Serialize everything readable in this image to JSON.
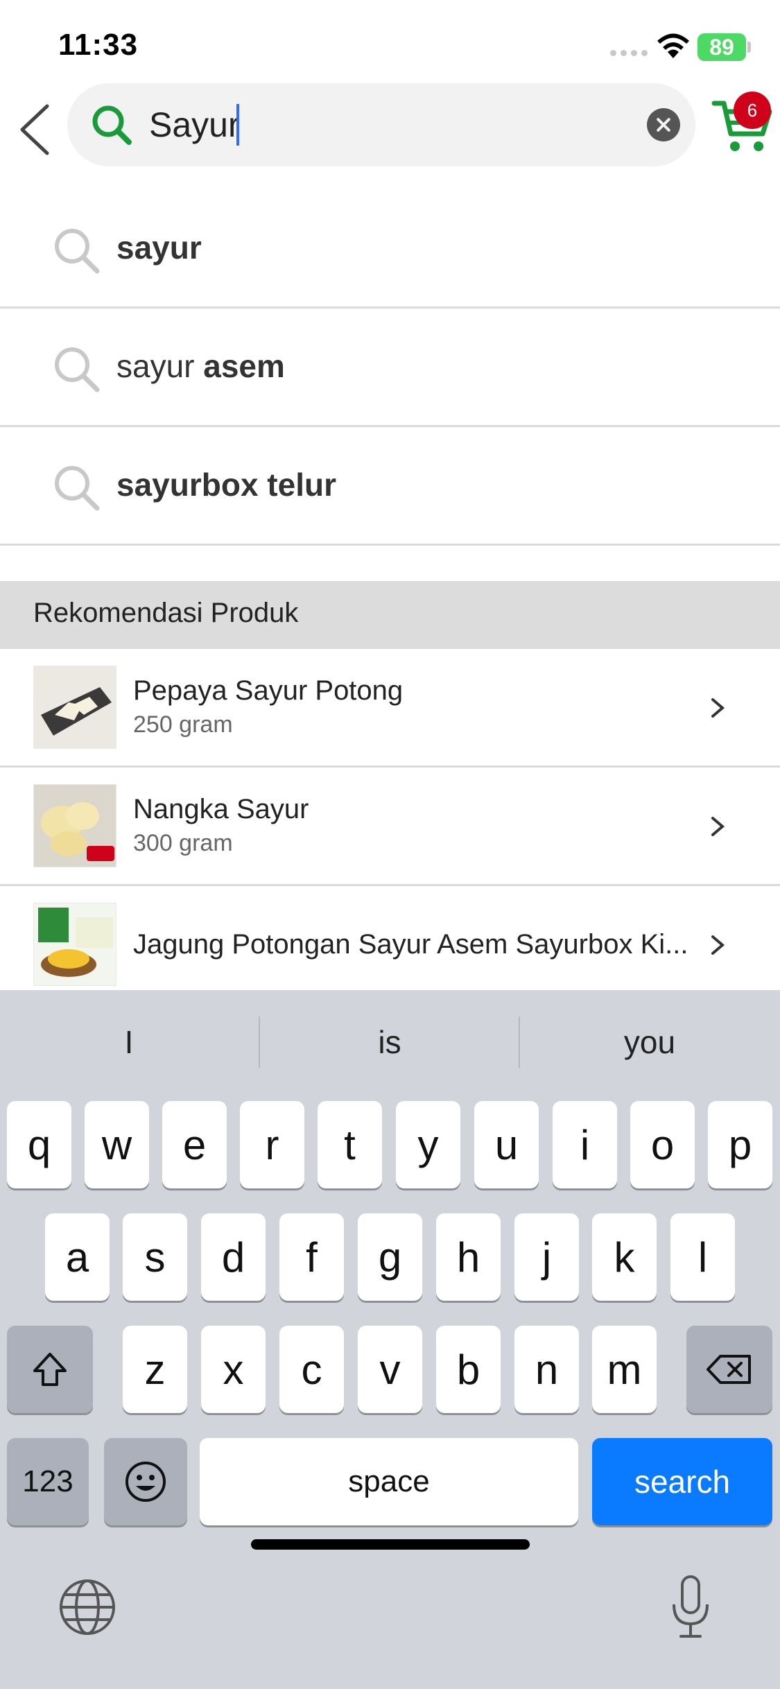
{
  "status_bar": {
    "time": "11:33",
    "battery": "89"
  },
  "search": {
    "query": "Sayur"
  },
  "cart": {
    "badge_count": "6"
  },
  "suggestions": [
    {
      "plain": "",
      "bold": "sayur"
    },
    {
      "plain": "sayur ",
      "bold": "asem"
    },
    {
      "plain": "",
      "bold": "sayurbox telur"
    }
  ],
  "recommendations": {
    "title": "Rekomendasi Produk",
    "items": [
      {
        "name": "Pepaya Sayur Potong",
        "weight": "250 gram"
      },
      {
        "name": "Nangka Sayur",
        "weight": "300 gram"
      },
      {
        "name": "Jagung Potongan Sayur Asem Sayurbox Ki...",
        "weight": ""
      }
    ]
  },
  "keyboard": {
    "predictions": [
      "I",
      "is",
      "you"
    ],
    "row1": [
      "q",
      "w",
      "e",
      "r",
      "t",
      "y",
      "u",
      "i",
      "o",
      "p"
    ],
    "row2": [
      "a",
      "s",
      "d",
      "f",
      "g",
      "h",
      "j",
      "k",
      "l"
    ],
    "row3": [
      "z",
      "x",
      "c",
      "v",
      "b",
      "n",
      "m"
    ],
    "numbers_label": "123",
    "space_label": "space",
    "search_label": "search"
  },
  "colors": {
    "brand_green": "#1a9b3a",
    "badge_red": "#d0021b",
    "keyboard_blue": "#0a7aff"
  },
  "icons": [
    "back-icon",
    "search-icon",
    "clear-icon",
    "cart-icon",
    "chevron-right-icon",
    "shift-icon",
    "backspace-icon",
    "emoji-icon",
    "globe-icon",
    "microphone-icon"
  ]
}
